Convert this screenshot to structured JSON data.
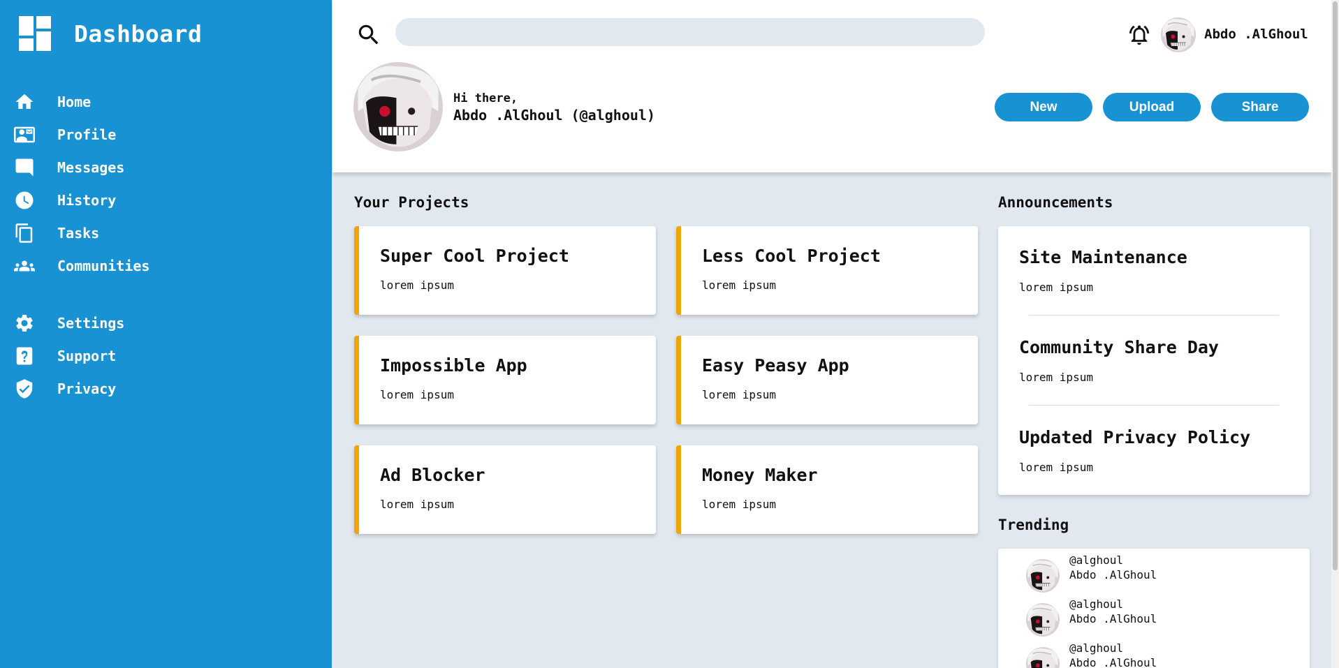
{
  "sidebar": {
    "title": "Dashboard",
    "items": [
      {
        "label": "Home",
        "icon": "home-icon"
      },
      {
        "label": "Profile",
        "icon": "profile-card-icon"
      },
      {
        "label": "Messages",
        "icon": "message-icon"
      },
      {
        "label": "History",
        "icon": "clock-icon"
      },
      {
        "label": "Tasks",
        "icon": "document-icon"
      },
      {
        "label": "Communities",
        "icon": "people-icon"
      },
      {
        "label": "Settings",
        "icon": "gear-icon"
      },
      {
        "label": "Support",
        "icon": "help-icon"
      },
      {
        "label": "Privacy",
        "icon": "shield-icon"
      }
    ]
  },
  "header": {
    "search_placeholder": "",
    "user_name": "Abdo .AlGhoul",
    "greeting": "Hi there,",
    "greeting_name": "Abdo .AlGhoul (@alghoul)",
    "buttons": {
      "new": "New",
      "upload": "Upload",
      "share": "Share"
    }
  },
  "projects": {
    "title": "Your Projects",
    "items": [
      {
        "name": "Super Cool Project",
        "desc": "lorem ipsum"
      },
      {
        "name": "Less Cool Project",
        "desc": "lorem ipsum"
      },
      {
        "name": "Impossible App",
        "desc": "lorem ipsum"
      },
      {
        "name": "Easy Peasy App",
        "desc": "lorem ipsum"
      },
      {
        "name": "Ad Blocker",
        "desc": "lorem ipsum"
      },
      {
        "name": "Money Maker",
        "desc": "lorem ipsum"
      }
    ]
  },
  "announcements": {
    "title": "Announcements",
    "items": [
      {
        "title": "Site Maintenance",
        "desc": "lorem ipsum"
      },
      {
        "title": "Community Share Day",
        "desc": "lorem ipsum"
      },
      {
        "title": "Updated Privacy Policy",
        "desc": "lorem ipsum"
      }
    ]
  },
  "trending": {
    "title": "Trending",
    "items": [
      {
        "handle": "@alghoul",
        "name": "Abdo .AlGhoul"
      },
      {
        "handle": "@alghoul",
        "name": "Abdo .AlGhoul"
      },
      {
        "handle": "@alghoul",
        "name": "Abdo .AlGhoul"
      }
    ]
  },
  "colors": {
    "accent": "#1992d4",
    "card_border": "#f0a30a",
    "background": "#e2e8f0"
  }
}
